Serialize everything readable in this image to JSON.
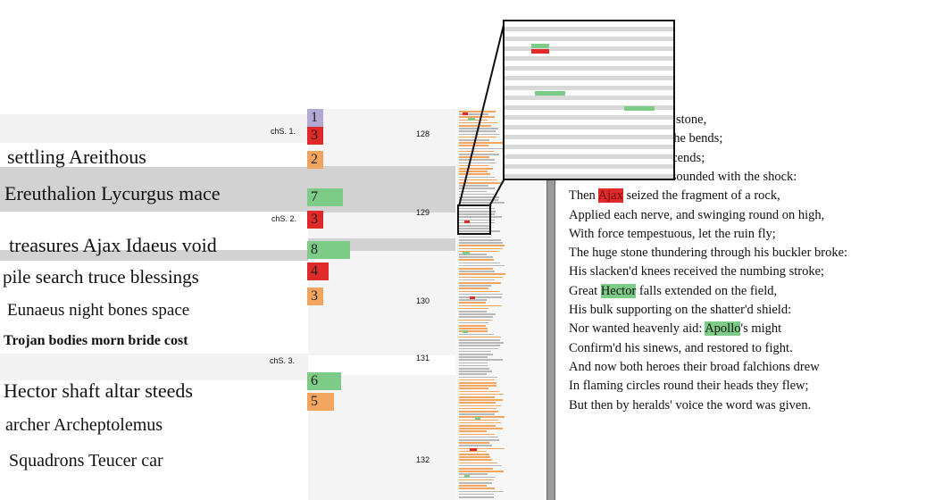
{
  "word_rows": [
    {
      "text": "settling  Areithous",
      "size": 22
    },
    {
      "text": "Ereuthalion  Lycurgus  mace",
      "size": 22
    },
    {
      "text": "treasures  Ajax  Idaeus  void",
      "size": 22
    },
    {
      "text": "pile  search  truce  blessings",
      "size": 21
    },
    {
      "text": "Eunaeus  night  bones  space",
      "size": 19
    },
    {
      "text": "Trojan  bodies  morn  bride  cost",
      "size": 16
    },
    {
      "text": "Hector  shaft  altar  steeds",
      "size": 22
    },
    {
      "text": "archer  Archeptolemus",
      "size": 20
    },
    {
      "text": "Squadrons  Teucer  car",
      "size": 20
    }
  ],
  "chips": [
    {
      "label": "1",
      "color": "#b3a7d4"
    },
    {
      "label": "3",
      "color": "#e02a2a"
    },
    {
      "label": "2",
      "color": "#f2a55e"
    },
    {
      "label": "7",
      "color": "#7ccb86"
    },
    {
      "label": "3",
      "color": "#e02a2a"
    },
    {
      "label": "8",
      "color": "#7ccb86"
    },
    {
      "label": "4",
      "color": "#e02a2a"
    },
    {
      "label": "3",
      "color": "#f2a55e"
    },
    {
      "label": "6",
      "color": "#7ccb86"
    },
    {
      "label": "5",
      "color": "#f2a55e"
    }
  ],
  "chapter_labels": [
    "chS. 1.",
    "chS. 2.",
    "chS. 3."
  ],
  "line_numbers": [
    "128",
    "129",
    "130",
    "131",
    "132"
  ],
  "text_lines": [
    [
      {
        "t": "d up-heaved a flinty stone,"
      }
    ],
    [
      {
        "t": "ast: to this his force he bends;"
      }
    ],
    [
      {
        "t": "n boss the stone descends;"
      }
    ],
    [
      {
        "t": "The hollow brass resounded with the shock:"
      }
    ],
    [
      {
        "t": "Then "
      },
      {
        "t": "Ajax",
        "h": "r"
      },
      {
        "t": " seized the fragment of a rock,"
      }
    ],
    [
      {
        "t": "Applied each nerve, and swinging round on high,"
      }
    ],
    [
      {
        "t": "With force tempestuous, let the ruin fly;"
      }
    ],
    [
      {
        "t": "The huge stone thundering through his buckler broke:"
      }
    ],
    [
      {
        "t": "His slacken'd knees received the numbing stroke;"
      }
    ],
    [
      {
        "t": "Great "
      },
      {
        "t": "Hector",
        "h": "g"
      },
      {
        "t": " falls extended on the field,"
      }
    ],
    [
      {
        "t": "His bulk supporting on the shatter'd shield:"
      }
    ],
    [
      {
        "t": "Nor wanted heavenly aid: "
      },
      {
        "t": "Apollo",
        "h": "g"
      },
      {
        "t": "'s might"
      }
    ],
    [
      {
        "t": "Confirm'd his sinews, and restored to fight."
      }
    ],
    [
      {
        "t": "And now both heroes their broad falchions drew"
      }
    ],
    [
      {
        "t": "In flaming circles round their heads they flew;"
      }
    ],
    [
      {
        "t": "But then by heralds' voice the word was given."
      }
    ]
  ],
  "colors": {
    "green": "#7ccb86",
    "red": "#e02a2a",
    "orange": "#f2a55e",
    "purple": "#b3a7d4"
  }
}
